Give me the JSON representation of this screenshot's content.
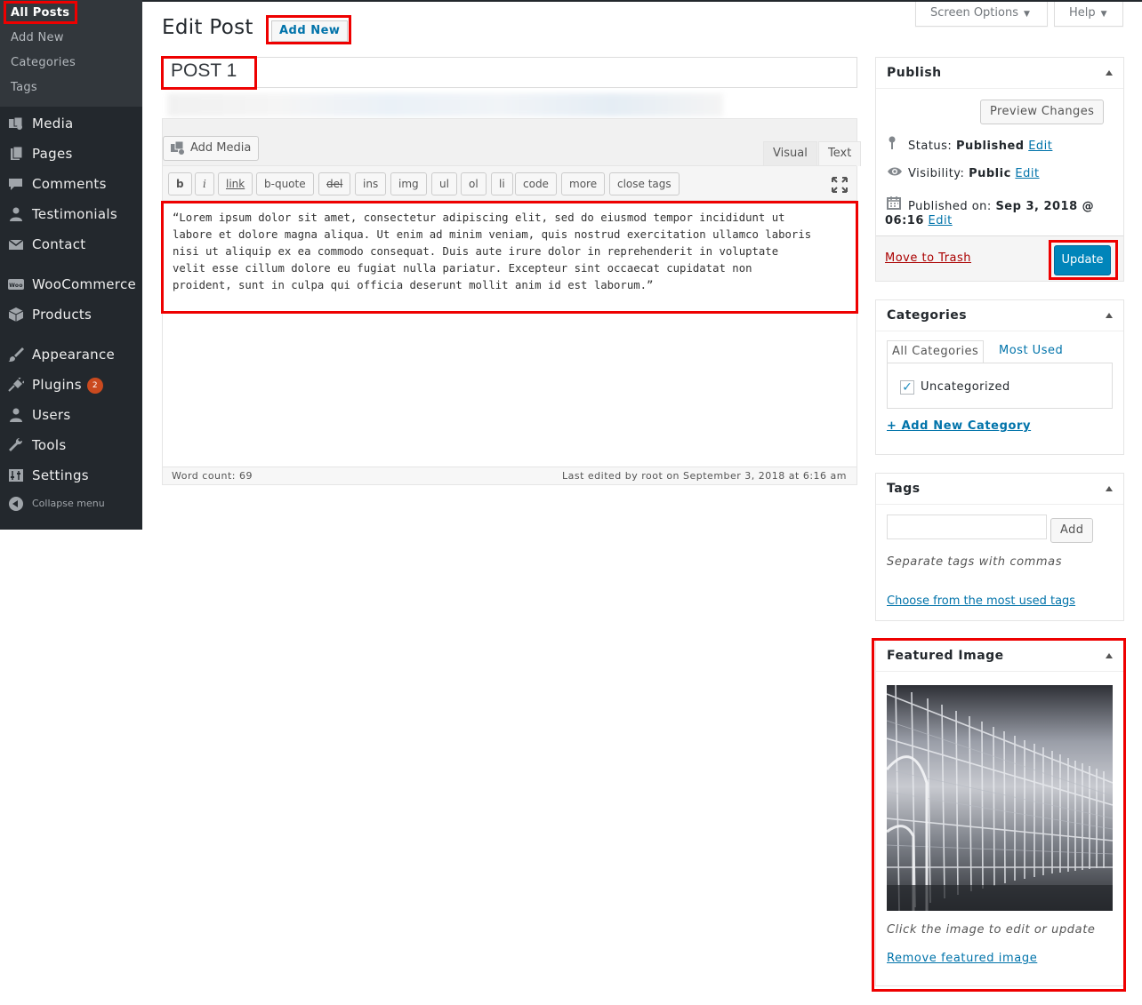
{
  "sidebar": {
    "submenu": [
      {
        "label": "All Posts"
      },
      {
        "label": "Add New"
      },
      {
        "label": "Categories"
      },
      {
        "label": "Tags"
      }
    ],
    "menu": [
      {
        "label": "Media",
        "icon": "media-icon"
      },
      {
        "label": "Pages",
        "icon": "pages-icon"
      },
      {
        "label": "Comments",
        "icon": "comments-icon"
      },
      {
        "label": "Testimonials",
        "icon": "person-icon"
      },
      {
        "label": "Contact",
        "icon": "mail-icon"
      },
      {
        "label": "WooCommerce",
        "icon": "woo-icon"
      },
      {
        "label": "Products",
        "icon": "box-icon"
      },
      {
        "label": "Appearance",
        "icon": "brush-icon"
      },
      {
        "label": "Plugins",
        "icon": "plug-icon",
        "badge": "2"
      },
      {
        "label": "Users",
        "icon": "users-icon"
      },
      {
        "label": "Tools",
        "icon": "wrench-icon"
      },
      {
        "label": "Settings",
        "icon": "settings-icon"
      }
    ],
    "collapse_label": "Collapse menu"
  },
  "screen_meta": {
    "screen_options": "Screen Options",
    "help": "Help"
  },
  "header": {
    "title": "Edit Post",
    "add_new": "Add New"
  },
  "post": {
    "title": "POST 1",
    "content": "“Lorem ipsum dolor sit amet, consectetur adipiscing elit, sed do eiusmod tempor incididunt ut\nlabore et dolore magna aliqua. Ut enim ad minim veniam, quis nostrud exercitation ullamco laboris\nnisi ut aliquip ex ea commodo consequat. Duis aute irure dolor in reprehenderit in voluptate\nvelit esse cillum dolore eu fugiat nulla pariatur. Excepteur sint occaecat cupidatat non\nproident, sunt in culpa qui officia deserunt mollit anim id est laborum.”"
  },
  "editor": {
    "add_media": "Add Media",
    "tabs": {
      "visual": "Visual",
      "text": "Text"
    },
    "quicktags": [
      "b",
      "i",
      "link",
      "b-quote",
      "del",
      "ins",
      "img",
      "ul",
      "ol",
      "li",
      "code",
      "more",
      "close tags"
    ],
    "word_count": "Word count: 69",
    "last_edited": "Last edited by root on September 3, 2018 at 6:16 am"
  },
  "publish": {
    "title": "Publish",
    "preview": "Preview Changes",
    "status_label": "Status:",
    "status_value": "Published",
    "visibility_label": "Visibility:",
    "visibility_value": "Public",
    "published_label": "Published on:",
    "published_value": "Sep 3, 2018 @",
    "published_time": "06:16",
    "edit": "Edit",
    "trash": "Move to Trash",
    "update": "Update"
  },
  "categories": {
    "title": "Categories",
    "tab_all": "All Categories",
    "tab_used": "Most Used",
    "items": [
      {
        "label": "Uncategorized",
        "checked": true
      }
    ],
    "add_new": "+ Add New Category"
  },
  "tags": {
    "title": "Tags",
    "add": "Add",
    "hint": "Separate tags with commas",
    "choose": "Choose from the most used tags"
  },
  "featured": {
    "title": "Featured Image",
    "hint": "Click the image to edit or update",
    "remove": "Remove featured image"
  },
  "colors": {
    "sidebar_bg": "#23282d",
    "accent": "#0073aa",
    "primary_button": "#0085ba",
    "highlight": "#ee0000"
  }
}
